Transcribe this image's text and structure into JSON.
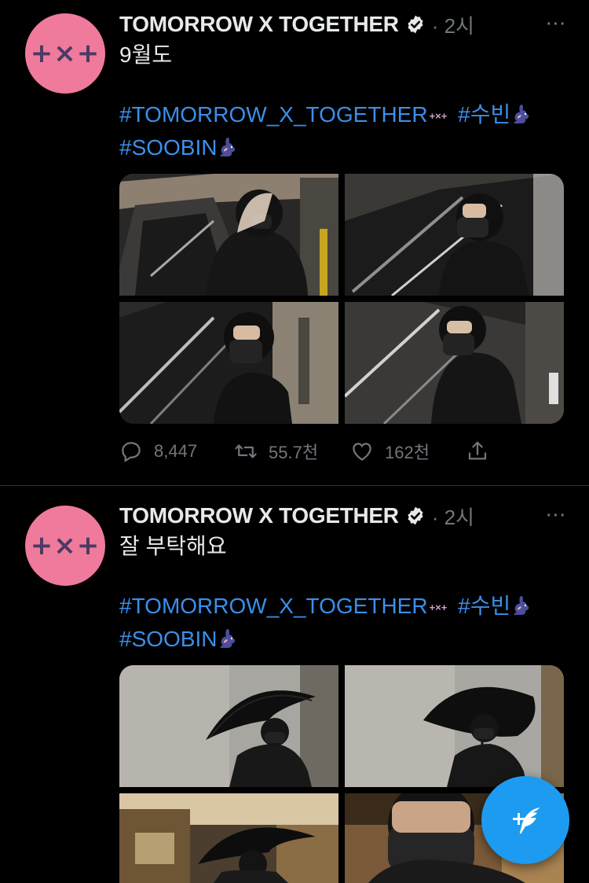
{
  "tweets": [
    {
      "avatar_text": "+×+",
      "author": "TOMORROW X TOGETHER",
      "time": "· 2시",
      "more": "···",
      "text": "9월도",
      "hashtag_1": "#TOMORROW_X_TOGETHER",
      "hashtag_1_emoji": "+×+",
      "hashtag_2": "#수빈",
      "hashtag_3": "#SOOBIN",
      "stats": {
        "replies": "8,447",
        "retweets": "55.7천",
        "likes": "162천"
      }
    },
    {
      "avatar_text": "+×+",
      "author": "TOMORROW X TOGETHER",
      "time": "· 2시",
      "more": "···",
      "text": "잘 부탁해요",
      "hashtag_1": "#TOMORROW_X_TOGETHER",
      "hashtag_1_emoji": "+×+",
      "hashtag_2": "#수빈",
      "hashtag_3": "#SOOBIN"
    }
  ],
  "icons": [
    "verified-icon",
    "reply-icon",
    "retweet-icon",
    "like-icon",
    "share-icon",
    "compose-icon",
    "bunny-emoji-icon"
  ],
  "colors": {
    "background": "#000000",
    "link": "#1d9bf0",
    "muted": "#71767b",
    "avatar": "#f07a9c",
    "fab": "#1d9bf0"
  }
}
